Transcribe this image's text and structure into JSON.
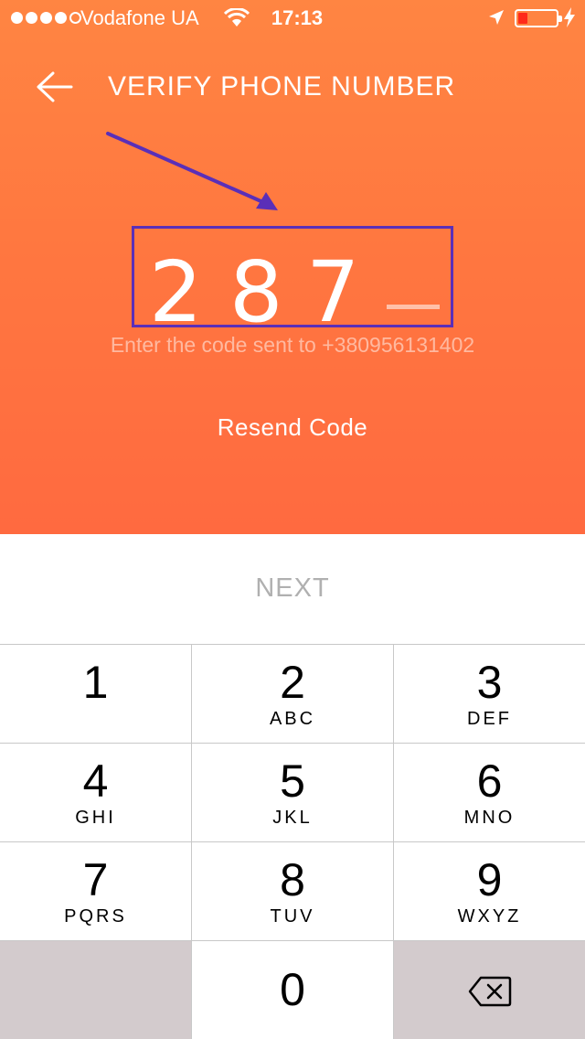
{
  "status_bar": {
    "carrier": "Vodafone UA",
    "time": "17:13",
    "signal_bars_filled": 4,
    "battery_level": 0.2
  },
  "header": {
    "back_icon": "arrow-left-icon",
    "title": "VERIFY PHONE NUMBER"
  },
  "code": {
    "digits": [
      "2",
      "8",
      "7"
    ],
    "length": 4
  },
  "hint": "Enter the code sent to +380956131402",
  "resend_label": "Resend Code",
  "next_label": "NEXT",
  "keypad": {
    "keys": [
      {
        "num": "1",
        "letters": ""
      },
      {
        "num": "2",
        "letters": "ABC"
      },
      {
        "num": "3",
        "letters": "DEF"
      },
      {
        "num": "4",
        "letters": "GHI"
      },
      {
        "num": "5",
        "letters": "JKL"
      },
      {
        "num": "6",
        "letters": "MNO"
      },
      {
        "num": "7",
        "letters": "PQRS"
      },
      {
        "num": "8",
        "letters": "TUV"
      },
      {
        "num": "9",
        "letters": "WXYZ"
      },
      {
        "num": "0",
        "letters": ""
      }
    ],
    "delete_icon": "backspace-icon"
  },
  "colors": {
    "accent": "#ff7a40",
    "annotation": "#5a2fb8",
    "keypad_dark": "#d3cbcd"
  }
}
